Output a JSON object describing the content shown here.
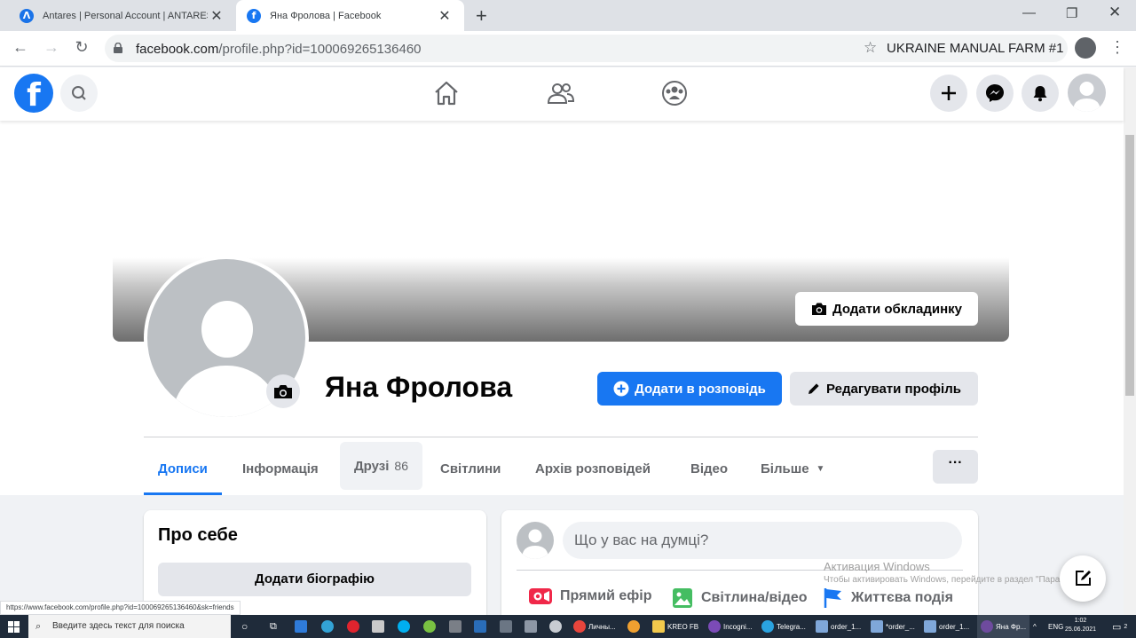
{
  "browser": {
    "tabs": [
      {
        "title": "Antares | Personal Account | ANTARES",
        "icon": "antares-icon",
        "active": false
      },
      {
        "title": "Яна Фролова | Facebook",
        "icon": "facebook-icon",
        "active": true
      }
    ],
    "url_host": "facebook.com",
    "url_path": "/profile.php?id=100069265136460",
    "profile_label": "UKRAINE MANUAL FARM #1",
    "status_url": "https://www.facebook.com/profile.php?id=100069265136460&sk=friends"
  },
  "profile": {
    "name": "Яна Фролова",
    "add_cover_label": "Додати обкладинку",
    "add_story_label": "Додати в розповідь",
    "edit_profile_label": "Редагувати профіль",
    "tabs": [
      {
        "label": "Дописи",
        "active": true
      },
      {
        "label": "Інформація"
      },
      {
        "label": "Друзі",
        "count": "86"
      },
      {
        "label": "Світлини"
      },
      {
        "label": "Архів розповідей"
      },
      {
        "label": "Відео"
      },
      {
        "label": "Більше"
      }
    ],
    "more_label": "···"
  },
  "about": {
    "title": "Про себе",
    "add_bio_label": "Додати біографію"
  },
  "composer": {
    "placeholder": "Що у вас на думці?",
    "actions": [
      {
        "label": "Прямий ефір",
        "icon": "live-video-icon",
        "color": "#f02849"
      },
      {
        "label": "Світлина/відео",
        "icon": "photo-icon",
        "color": "#45bd62"
      },
      {
        "label": "Життєва подія",
        "icon": "flag-icon",
        "color": "#1877f2"
      }
    ]
  },
  "windows_activation": {
    "title": "Активация Windows",
    "subtitle": "Чтобы активировать Windows, перейдите в раздел \"Парам"
  },
  "taskbar": {
    "search_placeholder": "Введите здесь текст для поиска",
    "items": [
      {
        "label": "Личны..."
      },
      {
        "label": "KREO FB"
      },
      {
        "label": "Incogni..."
      },
      {
        "label": "Telegra..."
      },
      {
        "label": "order_1..."
      },
      {
        "label": "*order_..."
      },
      {
        "label": "order_1..."
      },
      {
        "label": "Яна Фр..."
      }
    ],
    "lang": "ENG",
    "time": "1:02",
    "date": "25.06.2021",
    "notifications": "2"
  },
  "colors": {
    "fb_blue": "#1877f2",
    "text": "#050505",
    "secondary_text": "#65676b",
    "button_gray": "#e4e6eb"
  }
}
